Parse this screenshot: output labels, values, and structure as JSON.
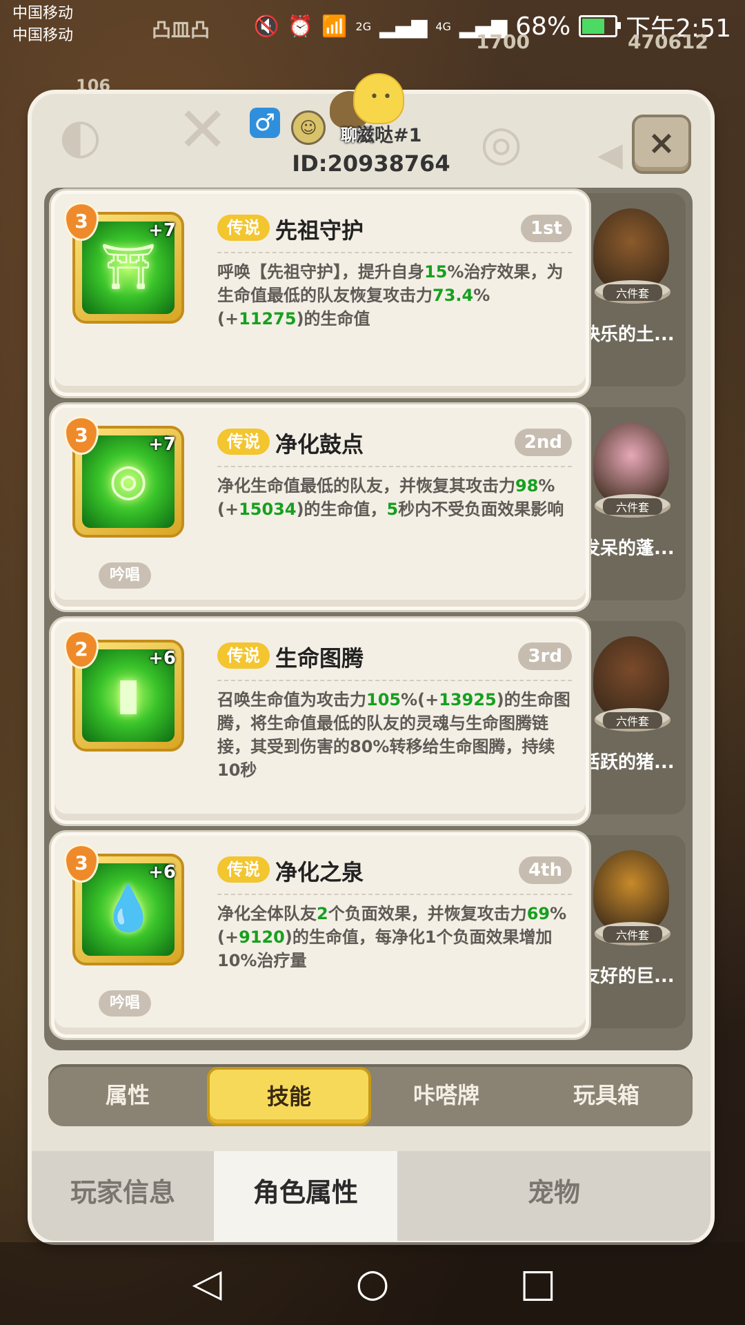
{
  "status_bar": {
    "carrier_1": "中国移动",
    "carrier_2": "中国移动",
    "net_2g": "2G",
    "net_4g": "4G",
    "battery": "68%",
    "time": "下午2:51"
  },
  "hud": {
    "player_tag": "凸皿凸",
    "level": "106",
    "coins": "1700",
    "gems": "470612"
  },
  "panel": {
    "chat_label": "聊天",
    "player_name": "滋哒#1",
    "player_id": "ID:20938764",
    "close_icon": "×"
  },
  "skills": [
    {
      "level": "3",
      "plus": "+7",
      "rarity": "传说",
      "name": "先祖守护",
      "rank": "1st",
      "desc_parts": [
        {
          "t": "呼唤【先祖守护】，提升自身"
        },
        {
          "t": "15",
          "hl": true
        },
        {
          "t": "%治疗效果，为生命值最低的队友恢复攻击力"
        },
        {
          "t": "73.4",
          "hl": true
        },
        {
          "t": "%(+"
        },
        {
          "t": "11275",
          "hl": true
        },
        {
          "t": ")的生命值"
        }
      ],
      "chant": "",
      "pet_name": "快乐的土...",
      "set_label": "六件套"
    },
    {
      "level": "3",
      "plus": "+7",
      "rarity": "传说",
      "name": "净化鼓点",
      "rank": "2nd",
      "desc_parts": [
        {
          "t": "净化生命值最低的队友，并恢复其攻击力"
        },
        {
          "t": "98",
          "hl": true
        },
        {
          "t": "%(+"
        },
        {
          "t": "15034",
          "hl": true
        },
        {
          "t": ")的生命值，"
        },
        {
          "t": "5",
          "hl": true
        },
        {
          "t": "秒内不受负面效果影响"
        }
      ],
      "chant": "吟唱",
      "pet_name": "发呆的蓬...",
      "set_label": "六件套"
    },
    {
      "level": "2",
      "plus": "+6",
      "rarity": "传说",
      "name": "生命图腾",
      "rank": "3rd",
      "desc_parts": [
        {
          "t": "召唤生命值为攻击力"
        },
        {
          "t": "105",
          "hl": true
        },
        {
          "t": "%(+"
        },
        {
          "t": "13925",
          "hl": true
        },
        {
          "t": ")的生命图腾，将生命值最低的队友的灵魂与生命图腾链接，其受到伤害的80%转移给生命图腾，持续10秒"
        }
      ],
      "chant": "",
      "pet_name": "活跃的猪...",
      "set_label": "六件套"
    },
    {
      "level": "3",
      "plus": "+6",
      "rarity": "传说",
      "name": "净化之泉",
      "rank": "4th",
      "desc_parts": [
        {
          "t": "净化全体队友"
        },
        {
          "t": "2",
          "hl": true
        },
        {
          "t": "个负面效果，并恢复攻击力"
        },
        {
          "t": "69",
          "hl": true
        },
        {
          "t": "%(+"
        },
        {
          "t": "9120",
          "hl": true
        },
        {
          "t": ")的生命值，每净化1个负面效果增加10%治疗量"
        }
      ],
      "chant": "吟唱",
      "pet_name": "友好的巨...",
      "set_label": "六件套"
    }
  ],
  "sub_tabs": [
    "属性",
    "技能",
    "咔嗒牌",
    "玩具箱"
  ],
  "main_tabs": [
    "玩家信息",
    "角色属性",
    "宠物"
  ],
  "nav": {
    "back": "◁",
    "home": "○",
    "recent": "□"
  }
}
